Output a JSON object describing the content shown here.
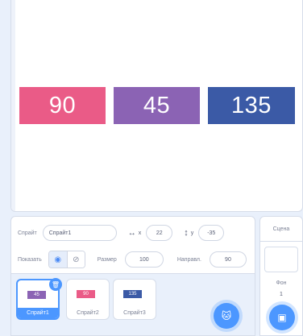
{
  "stage": {
    "tiles": [
      {
        "value": "90",
        "color": "#ea5b87"
      },
      {
        "value": "45",
        "color": "#8b63b4"
      },
      {
        "value": "135",
        "color": "#3b5aa6"
      }
    ]
  },
  "sprite_info": {
    "sprite_label": "Спрайт",
    "sprite_name": "Спрайт1",
    "x_label": "x",
    "x_value": "22",
    "y_label": "y",
    "y_value": "-35",
    "show_label": "Показать",
    "size_label": "Размер",
    "size_value": "100",
    "direction_label": "Направл.",
    "direction_value": "90"
  },
  "sprites": [
    {
      "name": "Спрайт1",
      "thumb_text": "45",
      "thumb_color": "#8b63b4",
      "selected": true
    },
    {
      "name": "Спрайт2",
      "thumb_text": "90",
      "thumb_color": "#ea5b87",
      "selected": false
    },
    {
      "name": "Спрайт3",
      "thumb_text": "135",
      "thumb_color": "#3b5aa6",
      "selected": false
    }
  ],
  "scene": {
    "title": "Сцена",
    "backdrops_label": "Фон",
    "backdrops_count": "1"
  },
  "colors": {
    "accent": "#4c97ff",
    "panel_bg": "#e9f0fb"
  }
}
